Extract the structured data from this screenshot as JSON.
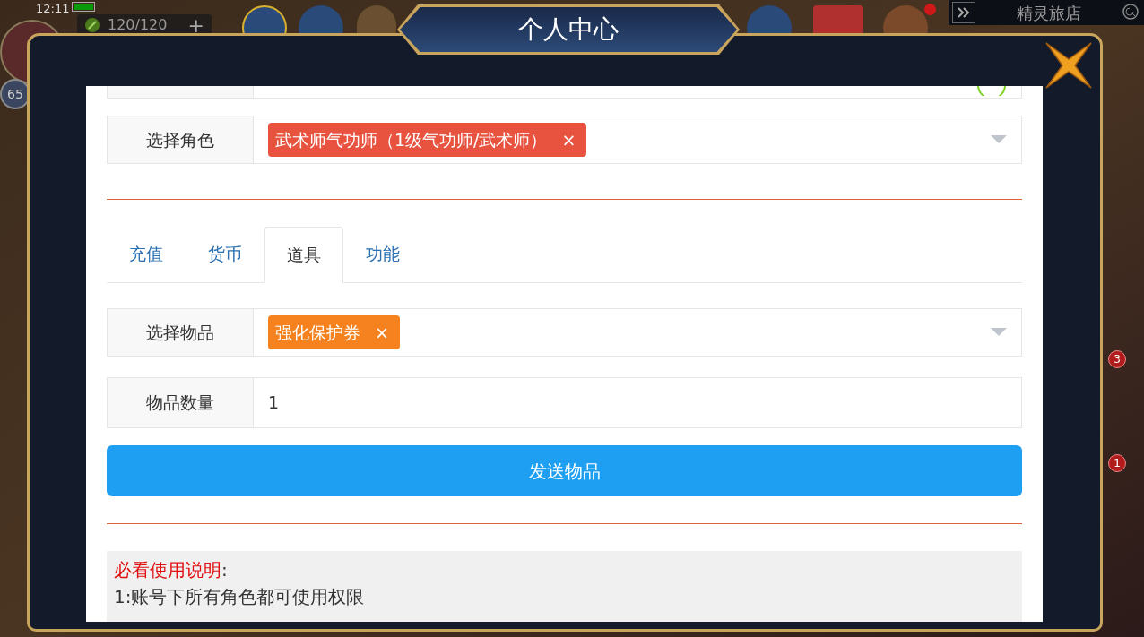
{
  "hud": {
    "time": "12:11",
    "stamina": "120/120",
    "add": "+",
    "level": "65",
    "shop": "精灵旅店",
    "badges": [
      "3",
      "1"
    ]
  },
  "dialog": {
    "title": "个人中心"
  },
  "role_field": {
    "label": "选择角色",
    "tags": [
      {
        "text": "武术师气功师（1级气功师/武术师）",
        "remove": "×",
        "color": "#e8533f"
      }
    ]
  },
  "tabs": [
    {
      "label": "充值",
      "selected": false
    },
    {
      "label": "货币",
      "selected": false
    },
    {
      "label": "道具",
      "selected": true
    },
    {
      "label": "功能",
      "selected": false
    }
  ],
  "item_field": {
    "label": "选择物品",
    "tags": [
      {
        "text": "强化保护券",
        "remove": "×",
        "color": "#f5821f"
      }
    ]
  },
  "quantity": {
    "label": "物品数量",
    "value": "1"
  },
  "send_button": "发送物品",
  "notice": {
    "heading": "必看使用说明",
    "colon": ":",
    "lines": [
      "1:账号下所有角色都可使用权限"
    ]
  }
}
